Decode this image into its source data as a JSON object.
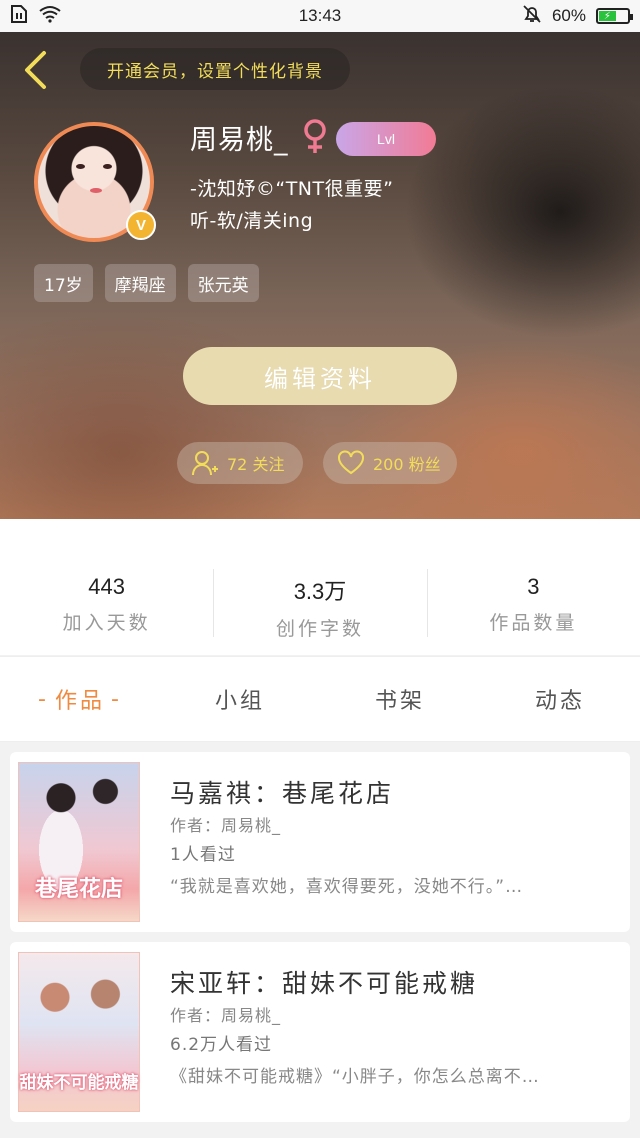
{
  "status_bar": {
    "time": "13:43",
    "battery_percent": "60%",
    "battery_level": 0.6
  },
  "header": {
    "vip_banner": "开通会员，设置个性化背景",
    "username": "周易桃_",
    "level": "Lvl",
    "bio_line1": "-沈知妤©“TNT很重要”",
    "bio_line2": "听-软/清关ing",
    "tags": [
      "17岁",
      "摩羯座",
      "张元英"
    ],
    "edit_button": "编辑资料",
    "following_label": "72 关注",
    "fans_label": "200 粉丝",
    "verified_badge": "V"
  },
  "stats": [
    {
      "value": "443",
      "label": "加入天数"
    },
    {
      "value": "3.3万",
      "label": "创作字数"
    },
    {
      "value": "3",
      "label": "作品数量"
    }
  ],
  "tabs": [
    {
      "label": "作品",
      "active": true
    },
    {
      "label": "小组",
      "active": false
    },
    {
      "label": "书架",
      "active": false
    },
    {
      "label": "动态",
      "active": false
    }
  ],
  "tab_dash": "-",
  "works": [
    {
      "title": "马嘉祺：巷尾花店",
      "author": "作者：周易桃_",
      "views": "1人看过",
      "excerpt": "“我就是喜欢她，喜欢得要死，没她不行。”…",
      "cover_text": "巷尾花店"
    },
    {
      "title": "宋亚轩：甜妹不可能戒糖",
      "author": "作者：周易桃_",
      "views": "6.2万人看过",
      "excerpt": "《甜妹不可能戒糖》“小胖子，你怎么总离不…",
      "cover_text": "甜妹不可能戒糖"
    }
  ],
  "colors": {
    "accent_orange": "#f08a40",
    "vip_yellow": "#f2dd5a",
    "edit_button_bg": "#e8dbb0",
    "level_gradient_start": "#c9a6e8",
    "level_gradient_end": "#f17b95"
  }
}
